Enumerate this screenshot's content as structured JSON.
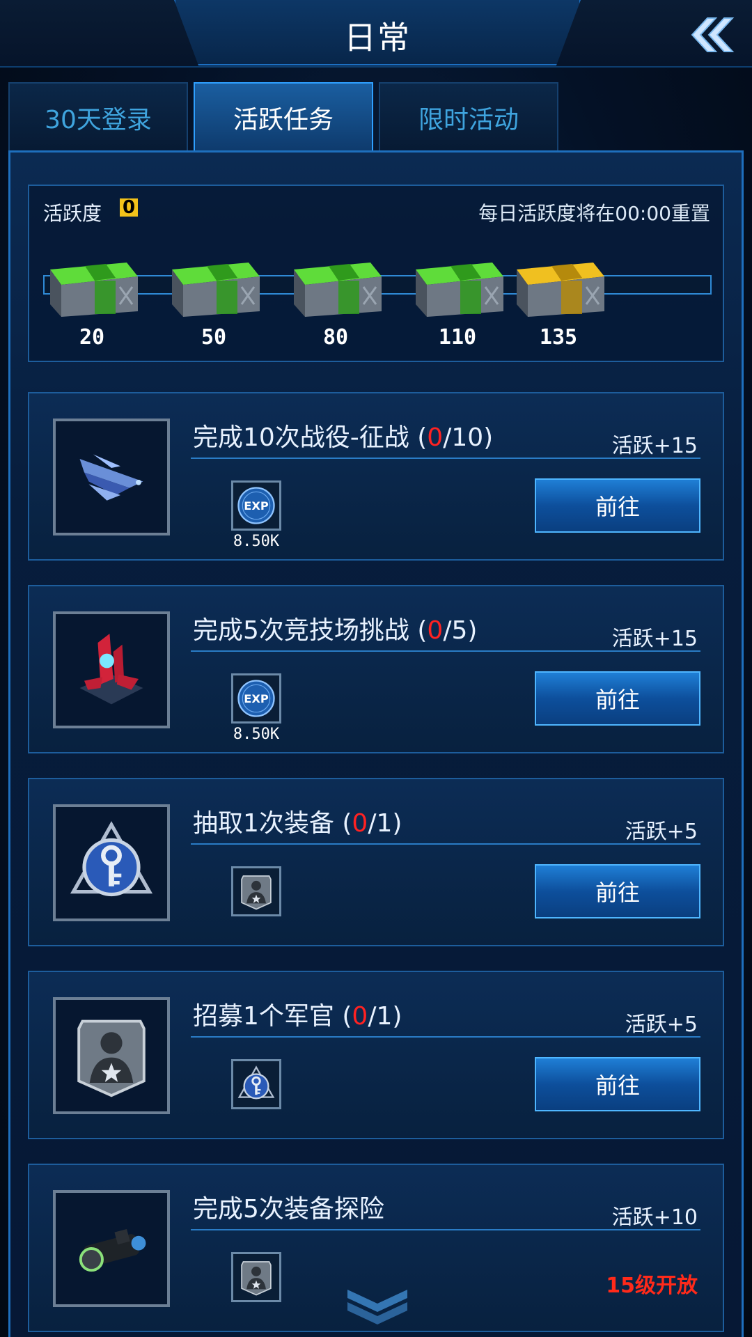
{
  "header": {
    "title": "日常"
  },
  "tabs": [
    {
      "label": "30天登录",
      "active": false
    },
    {
      "label": "活跃任务",
      "active": true
    },
    {
      "label": "限时活动",
      "active": false
    }
  ],
  "activity": {
    "label": "活跃度",
    "value": "0",
    "reset_text": "每日活跃度将在00:00重置",
    "progress": 0,
    "milestones": [
      {
        "points": "20",
        "chest": "green"
      },
      {
        "points": "50",
        "chest": "green"
      },
      {
        "points": "80",
        "chest": "green"
      },
      {
        "points": "110",
        "chest": "green"
      },
      {
        "points": "135",
        "chest": "gold"
      }
    ]
  },
  "tasks": [
    {
      "title_pre": "完成10次战役-征战 (",
      "done": "0",
      "title_post": "/10)",
      "points": "活跃+15",
      "icon": "spaceship-icon",
      "reward_icon": "exp-icon",
      "reward_amount": "8.50K",
      "button": "前往"
    },
    {
      "title_pre": "完成5次竞技场挑战 (",
      "done": "0",
      "title_post": "/5)",
      "points": "活跃+15",
      "icon": "arena-icon",
      "reward_icon": "exp-icon",
      "reward_amount": "8.50K",
      "button": "前往"
    },
    {
      "title_pre": "抽取1次装备 (",
      "done": "0",
      "title_post": "/1)",
      "points": "活跃+5",
      "icon": "key-emblem-icon",
      "reward_icon": "officer-badge-icon",
      "reward_amount": "",
      "button": "前往"
    },
    {
      "title_pre": "招募1个军官 (",
      "done": "0",
      "title_post": "/1)",
      "points": "活跃+5",
      "icon": "officer-badge-icon",
      "reward_icon": "key-emblem-icon",
      "reward_amount": "",
      "button": "前往"
    },
    {
      "title_pre": "完成5次装备探险",
      "done": "",
      "title_post": "",
      "points": "活跃+10",
      "icon": "scope-icon",
      "reward_icon": "officer-badge-icon",
      "reward_amount": "",
      "locked_text": "15级开放"
    }
  ],
  "colors": {
    "accent": "#2fa0ff",
    "gold": "#f2c21a",
    "red": "#ff2222"
  }
}
